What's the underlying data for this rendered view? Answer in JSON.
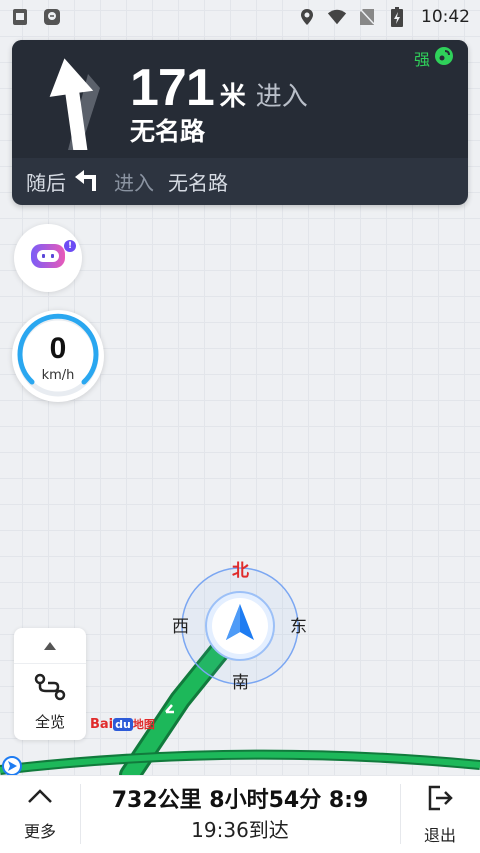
{
  "status_bar": {
    "time": "10:42",
    "left_icons": [
      "app-notification-icon",
      "navigation-app-icon"
    ],
    "right_icons": [
      "location-icon",
      "wifi-icon",
      "no-sim-icon",
      "battery-charging-icon"
    ]
  },
  "guidance": {
    "distance": "171",
    "distance_unit": "米",
    "action": "进入",
    "road_name": "无名路",
    "signal_label": "强",
    "next_prefix": "随后",
    "next_action": "进入",
    "next_road": "无名路",
    "turn_icon": "straight-arrow-icon",
    "next_turn_icon": "turn-left-icon"
  },
  "speed": {
    "value": "0",
    "unit": "km/h"
  },
  "compass": {
    "north": "北",
    "south": "南",
    "east": "东",
    "west": "西"
  },
  "controls": {
    "overview_label": "全览"
  },
  "logo": {
    "bai": "Bai",
    "du": "du",
    "map": "地图"
  },
  "bottom_bar": {
    "more_label": "更多",
    "trip_summary": "732公里 8小时54分 8:9",
    "arrival": "19:36到达",
    "exit_label": "退出"
  },
  "colors": {
    "route_green": "#1db85a",
    "panel_dark": "#262c36",
    "accent_blue": "#1e7cf2",
    "north_red": "#e02b2b"
  }
}
